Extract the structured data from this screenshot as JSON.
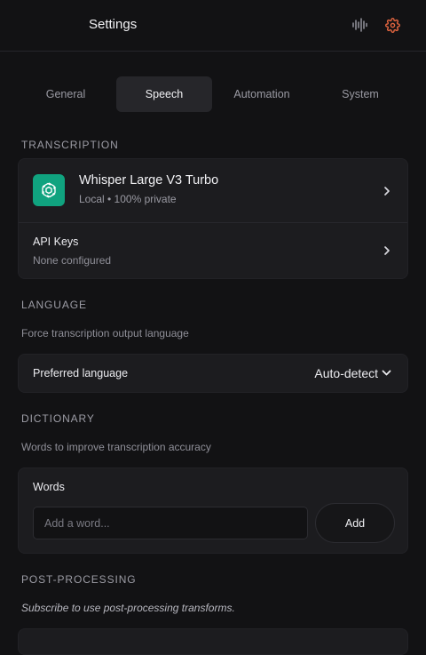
{
  "header": {
    "title": "Settings",
    "icons": {
      "waveform": "audio-waveform-icon",
      "settings": "gear-icon"
    },
    "accent_color": "#e0643f"
  },
  "tabs": [
    {
      "label": "General",
      "active": false
    },
    {
      "label": "Speech",
      "active": true
    },
    {
      "label": "Automation",
      "active": false
    },
    {
      "label": "System",
      "active": false
    }
  ],
  "transcription": {
    "label": "TRANSCRIPTION",
    "model": {
      "name": "Whisper Large V3 Turbo",
      "subtitle": "Local • 100% private",
      "logo": "openai-logo-icon",
      "logo_bg": "#10a37f"
    },
    "api_keys": {
      "title": "API Keys",
      "subtitle": "None configured"
    }
  },
  "language": {
    "label": "LANGUAGE",
    "description": "Force transcription output language",
    "preferred_label": "Preferred language",
    "preferred_value": "Auto-detect"
  },
  "dictionary": {
    "label": "DICTIONARY",
    "description": "Words to improve transcription accuracy",
    "words_label": "Words",
    "input_placeholder": "Add a word...",
    "add_label": "Add"
  },
  "post_processing": {
    "label": "POST-PROCESSING",
    "description": "Subscribe to use post-processing transforms."
  }
}
